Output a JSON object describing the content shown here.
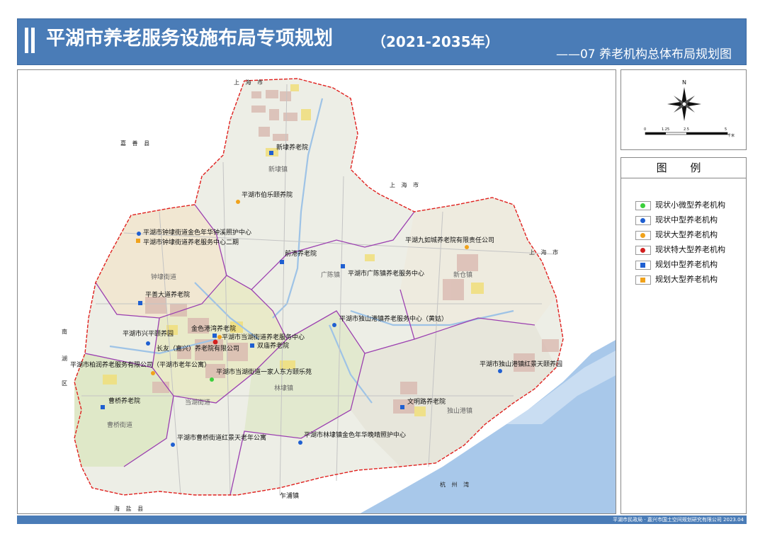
{
  "header": {
    "title": "平湖市养老服务设施布局专项规划",
    "title_year": "（2021-2035年）",
    "subtitle": "——07 养老机构总体布局规划图"
  },
  "compass": {
    "north_label": "N",
    "scale_labels": [
      "0",
      "1.25",
      "2.5",
      "5"
    ],
    "scale_unit": "千米"
  },
  "legend": {
    "title": "图  例",
    "items": [
      {
        "label": "现状小微型养老机构",
        "color": "#3ccf3c",
        "shape": "dot"
      },
      {
        "label": "现状中型养老机构",
        "color": "#1f5fd1",
        "shape": "dot"
      },
      {
        "label": "现状大型养老机构",
        "color": "#f0a21c",
        "shape": "dot"
      },
      {
        "label": "现状特大型养老机构",
        "color": "#d21f1f",
        "shape": "dot"
      },
      {
        "label": "规划中型养老机构",
        "color": "#1f5fd1",
        "shape": "square"
      },
      {
        "label": "规划大型养老机构",
        "color": "#f0a21c",
        "shape": "square"
      }
    ]
  },
  "footer": {
    "credit": "平湖市民政局 · 嘉兴市国土空间规划研究有限公司 2023.04"
  },
  "map": {
    "neighbor_regions": {
      "shanghai_top": "上 海 市",
      "shanghai_mid": "上 海 市",
      "shanghai_right": "上 海 市",
      "jiashan": "嘉 善 县",
      "nanhu_1": "南",
      "nanhu_2": "湖",
      "nanhu_3": "区",
      "haiyan": "海 盐 县",
      "hangzhou_bay": "杭 州 湾"
    },
    "towns": {
      "xindai": "新埭镇",
      "guangchen": "广陈镇",
      "xincang": "新仓镇",
      "zhongdai": "钟埭街道",
      "danghu": "当湖街道",
      "linda": "林埭镇",
      "caoqiao": "曹桥街道",
      "dushangang": "独山港镇",
      "zhapu": "乍浦镇"
    },
    "facilities": {
      "xindai": "新埭养老院",
      "bole": "平湖市伯乐颐养院",
      "zhongdai_jinse": "平湖市钟埭街道金色年华钟溪照护中心",
      "zhongdai_center2": "平湖市钟埭街道养老服务中心二期",
      "qiangang": "前港养老院",
      "guangchen": "平湖市广陈镇养老服务中心",
      "jiuru": "平湖九如城养老院有限责任公司",
      "pingshan": "平善大道养老院",
      "dushangang_huanggu": "平湖市独山港镇养老服务中心（黄姑）",
      "xingping": "平湖市兴平颐养园",
      "jinsegangwan": "金色港湾养老院",
      "danghu_center": "平湖市当湖街道养老服务中心",
      "changyou": "长友（嘉兴）养老院有限公司",
      "shuangmiao": "双庙养老院",
      "bairun": "平湖市柏润养老服务有限公司（平湖市老年公寓）",
      "yijiaren": "平湖市当湖街道一家人东方颐乐苑",
      "hongjing": "平湖市独山港镇红景天颐养园",
      "caoqiao": "曹桥养老院",
      "wenming": "文明路养老院",
      "caoqiao_hongjing": "平湖市曹桥街道红景天老年公寓",
      "linda_jinse": "平湖市林埭镇金色年华晚晴照护中心"
    }
  }
}
